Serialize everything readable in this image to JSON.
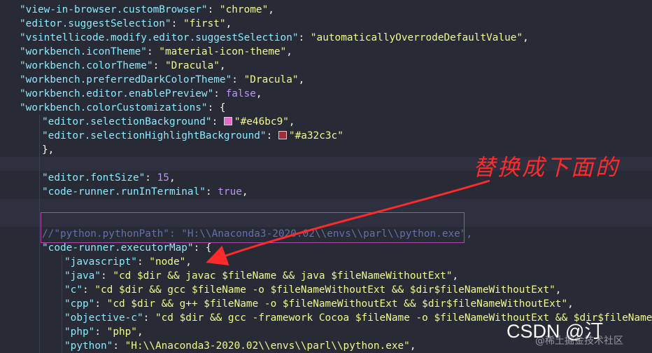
{
  "lines": [
    {
      "indent": 0,
      "guides": 0,
      "tokens": [
        {
          "t": "\"view-in-browser.customBrowser\"",
          "c": "k"
        },
        {
          "t": ": ",
          "c": "p"
        },
        {
          "t": "\"chrome\"",
          "c": "s"
        },
        {
          "t": ",",
          "c": "p"
        }
      ]
    },
    {
      "indent": 0,
      "guides": 0,
      "tokens": [
        {
          "t": "\"editor.suggestSelection\"",
          "c": "k"
        },
        {
          "t": ": ",
          "c": "p"
        },
        {
          "t": "\"first\"",
          "c": "s"
        },
        {
          "t": ",",
          "c": "p"
        }
      ]
    },
    {
      "indent": 0,
      "guides": 0,
      "tokens": [
        {
          "t": "\"vsintellicode.modify.editor.suggestSelection\"",
          "c": "k"
        },
        {
          "t": ": ",
          "c": "p"
        },
        {
          "t": "\"automaticallyOverrodeDefaultValue\"",
          "c": "s"
        },
        {
          "t": ",",
          "c": "p"
        }
      ]
    },
    {
      "indent": 0,
      "guides": 0,
      "tokens": [
        {
          "t": "\"workbench.iconTheme\"",
          "c": "k"
        },
        {
          "t": ": ",
          "c": "p"
        },
        {
          "t": "\"material-icon-theme\"",
          "c": "s"
        },
        {
          "t": ",",
          "c": "p"
        }
      ]
    },
    {
      "indent": 0,
      "guides": 0,
      "tokens": [
        {
          "t": "\"workbench.colorTheme\"",
          "c": "k"
        },
        {
          "t": ": ",
          "c": "p"
        },
        {
          "t": "\"Dracula\"",
          "c": "s"
        },
        {
          "t": ",",
          "c": "p"
        }
      ]
    },
    {
      "indent": 0,
      "guides": 0,
      "tokens": [
        {
          "t": "\"workbench.preferredDarkColorTheme\"",
          "c": "k"
        },
        {
          "t": ": ",
          "c": "p"
        },
        {
          "t": "\"Dracula\"",
          "c": "s"
        },
        {
          "t": ",",
          "c": "p"
        }
      ]
    },
    {
      "indent": 0,
      "guides": 0,
      "tokens": [
        {
          "t": "\"workbench.editor.enablePreview\"",
          "c": "k"
        },
        {
          "t": ": ",
          "c": "p"
        },
        {
          "t": "false",
          "c": "n"
        },
        {
          "t": ",",
          "c": "p"
        }
      ]
    },
    {
      "indent": 0,
      "guides": 0,
      "tokens": [
        {
          "t": "\"workbench.colorCustomizations\"",
          "c": "k"
        },
        {
          "t": ": {",
          "c": "p"
        }
      ]
    },
    {
      "indent": 1,
      "guides": 1,
      "tokens": [
        {
          "t": "\"editor.selectionBackground\"",
          "c": "k"
        },
        {
          "t": ": ",
          "c": "p"
        },
        {
          "sw": "#e46bc9"
        },
        {
          "t": "\"#e46bc9\"",
          "c": "s"
        },
        {
          "t": ",",
          "c": "p"
        }
      ]
    },
    {
      "indent": 1,
      "guides": 1,
      "tokens": [
        {
          "t": "\"editor.selectionHighlightBackground\"",
          "c": "k"
        },
        {
          "t": ": ",
          "c": "p"
        },
        {
          "sw": "#a32c3c"
        },
        {
          "t": "\"#a32c3c\"",
          "c": "s"
        }
      ]
    },
    {
      "indent": 1,
      "guides": 1,
      "tokens": [
        {
          "t": "},",
          "c": "p"
        }
      ]
    },
    {
      "indent": 0,
      "guides": 1,
      "hl": true,
      "tokens": []
    },
    {
      "indent": 1,
      "guides": 1,
      "tokens": [
        {
          "t": "\"editor.fontSize\"",
          "c": "k"
        },
        {
          "t": ": ",
          "c": "p"
        },
        {
          "t": "15",
          "c": "n"
        },
        {
          "t": ",",
          "c": "p"
        }
      ]
    },
    {
      "indent": 1,
      "guides": 1,
      "tokens": [
        {
          "t": "\"code-runner.runInTerminal\"",
          "c": "k"
        },
        {
          "t": ": ",
          "c": "p"
        },
        {
          "t": "true",
          "c": "n"
        },
        {
          "t": ",",
          "c": "p"
        }
      ]
    },
    {
      "indent": 0,
      "guides": 1,
      "hl": true,
      "tokens": []
    },
    {
      "indent": 0,
      "guides": 1,
      "hl": true,
      "tokens": []
    },
    {
      "indent": 1,
      "guides": 1,
      "tokens": [
        {
          "t": "//\"python.pythonPath\": \"H:\\\\Anaconda3-2020.02\\\\envs\\\\parl\\\\python.exe\",",
          "c": "c"
        }
      ]
    },
    {
      "indent": 1,
      "guides": 1,
      "tokens": [
        {
          "t": "\"code-runner.executorMap\"",
          "c": "k"
        },
        {
          "t": ": {",
          "c": "p"
        }
      ]
    },
    {
      "indent": 2,
      "guides": 2,
      "tokens": [
        {
          "t": "\"javascript\"",
          "c": "k"
        },
        {
          "t": ": ",
          "c": "p"
        },
        {
          "t": "\"node\"",
          "c": "s"
        },
        {
          "t": ",",
          "c": "p"
        }
      ]
    },
    {
      "indent": 2,
      "guides": 2,
      "tokens": [
        {
          "t": "\"java\"",
          "c": "k"
        },
        {
          "t": ": ",
          "c": "p"
        },
        {
          "t": "\"cd $dir && javac $fileName && java $fileNameWithoutExt\"",
          "c": "s"
        },
        {
          "t": ",",
          "c": "p"
        }
      ]
    },
    {
      "indent": 2,
      "guides": 2,
      "tokens": [
        {
          "t": "\"c\"",
          "c": "k"
        },
        {
          "t": ": ",
          "c": "p"
        },
        {
          "t": "\"cd $dir && gcc $fileName -o $fileNameWithoutExt && $dir$fileNameWithoutExt\"",
          "c": "s"
        },
        {
          "t": ",",
          "c": "p"
        }
      ]
    },
    {
      "indent": 2,
      "guides": 2,
      "tokens": [
        {
          "t": "\"cpp\"",
          "c": "k"
        },
        {
          "t": ": ",
          "c": "p"
        },
        {
          "t": "\"cd $dir && g++ $fileName -o $fileNameWithoutExt && $dir$fileNameWithoutExt\"",
          "c": "s"
        },
        {
          "t": ",",
          "c": "p"
        }
      ]
    },
    {
      "indent": 2,
      "guides": 2,
      "tokens": [
        {
          "t": "\"objective-c\"",
          "c": "k"
        },
        {
          "t": ": ",
          "c": "p"
        },
        {
          "t": "\"cd $dir && gcc -framework Cocoa $fileName -o $fileNameWithoutExt && $dir$fileNameWitho",
          "c": "s"
        }
      ]
    },
    {
      "indent": 2,
      "guides": 2,
      "tokens": [
        {
          "t": "\"php\"",
          "c": "k"
        },
        {
          "t": ": ",
          "c": "p"
        },
        {
          "t": "\"php\"",
          "c": "s"
        },
        {
          "t": ",",
          "c": "p"
        }
      ]
    },
    {
      "indent": 2,
      "guides": 2,
      "tokens": [
        {
          "t": "\"python\"",
          "c": "k"
        },
        {
          "t": ": ",
          "c": "p"
        },
        {
          "t": "\"H:\\\\Anaconda3-2020.02\\\\envs\\\\parl\\\\python.exe\"",
          "c": "s"
        },
        {
          "t": ",",
          "c": "p"
        }
      ]
    }
  ],
  "annotation": {
    "label": "替换成下面的",
    "color": "#ff2a2a"
  },
  "watermark": {
    "brand": "CSDN @汀",
    "site": "@稀土掘金技术社区"
  },
  "colors": {
    "background": "#282a36",
    "key": "#8be9fd",
    "string": "#f1fa8c",
    "number": "#bd93f9",
    "comment": "#6272a4",
    "box": "#b04ab0"
  }
}
